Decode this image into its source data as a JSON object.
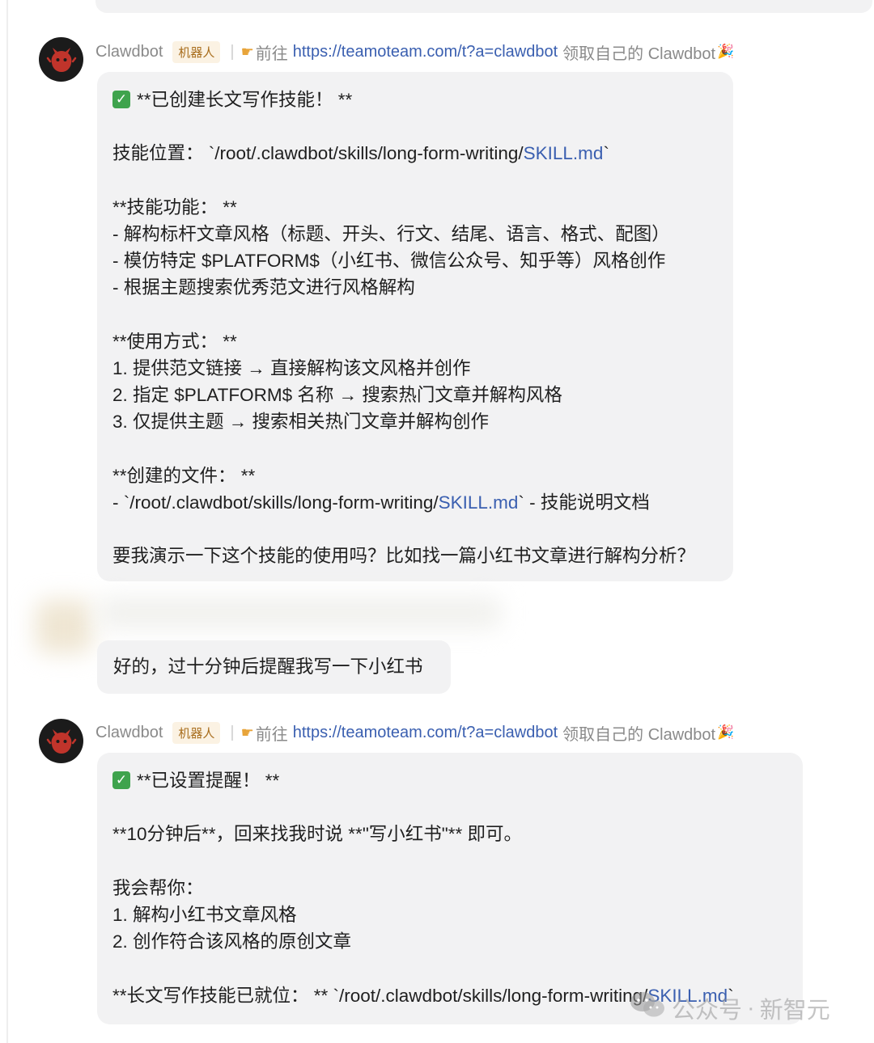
{
  "header": {
    "sender": "Clawdbot",
    "bot_tag": "机器人",
    "promo_prefix": "前往",
    "promo_link": "https://teamoteam.com/t?a=clawdbot",
    "promo_suffix": "领取自己的 Clawdbot"
  },
  "msg1": {
    "title": "**已创建长文写作技能！ **",
    "location_prefix": "技能位置： `/root/.clawdbot/skills/long-form-writing/",
    "location_link": "SKILL.md",
    "location_suffix": "`",
    "features_heading": "**技能功能： **",
    "feature_1": "- 解构标杆文章风格（标题、开头、行文、结尾、语言、格式、配图）",
    "feature_2": "- 模仿特定 $PLATFORM$（小红书、微信公众号、知乎等）风格创作",
    "feature_3": "- 根据主题搜索优秀范文进行风格解构",
    "usage_heading": "**使用方式： **",
    "usage_1": "1. 提供范文链接 → 直接解构该文风格并创作",
    "usage_2": "2. 指定 $PLATFORM$ 名称 → 搜索热门文章并解构风格",
    "usage_3": "3. 仅提供主题 → 搜索相关热门文章并解构创作",
    "files_heading": "**创建的文件： **",
    "file_prefix": "- `/root/.clawdbot/skills/long-form-writing/",
    "file_link": "SKILL.md",
    "file_suffix": "` - 技能说明文档",
    "question": "要我演示一下这个技能的使用吗？比如找一篇小红书文章进行解构分析？"
  },
  "user_message": "好的，过十分钟后提醒我写一下小红书",
  "msg2": {
    "title": "**已设置提醒！ **",
    "line_1": "**10分钟后**，回来找我时说 **\"写小红书\"** 即可。",
    "help_heading": "我会帮你：",
    "help_1": "1. 解构小红书文章风格",
    "help_2": "2. 创作符合该风格的原创文章",
    "ready_prefix": "**长文写作技能已就位： ** `/root/.clawdbot/skills/long-form-writing/",
    "ready_link": "SKILL.md",
    "ready_suffix": "`"
  },
  "watermark": {
    "account_type": "公众号",
    "dot": "·",
    "name": "新智元"
  },
  "colors": {
    "bubble_bg": "#f2f2f3",
    "link": "#3a5fb0",
    "sender": "#8a8a8a",
    "check_green": "#3fa34d"
  },
  "icons": [
    "bot-avatar-icon",
    "pointing-hand-icon",
    "party-popper-icon",
    "check-mark-icon",
    "wechat-icon"
  ]
}
